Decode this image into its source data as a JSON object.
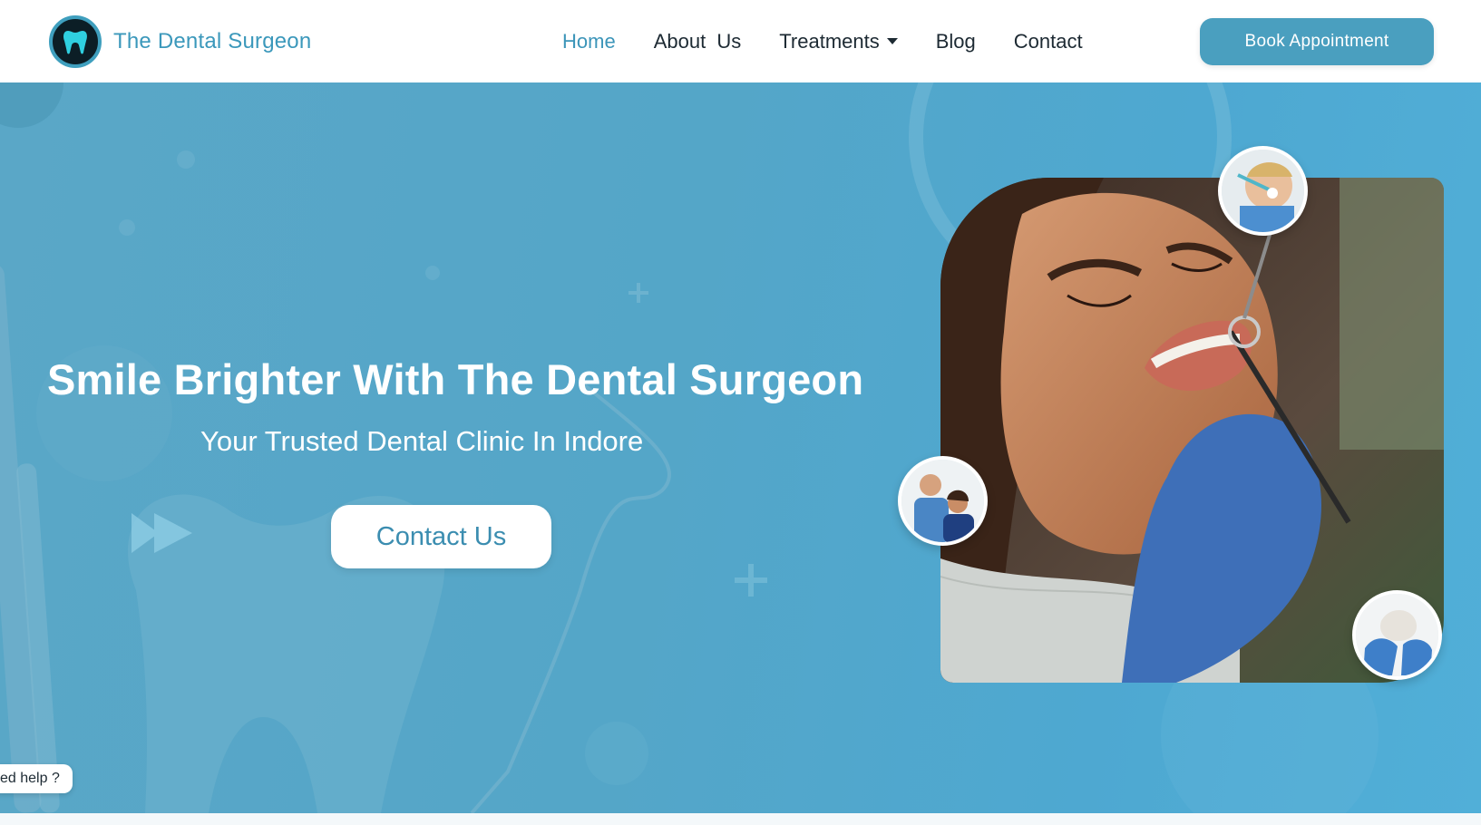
{
  "brand": {
    "name": "The Dental Surgeon",
    "logo_icon": "tooth-icon",
    "color_primary": "#3b98bb",
    "color_button": "#4a9fbf"
  },
  "nav": {
    "items": [
      {
        "label": "Home",
        "active": true
      },
      {
        "label": "About  Us",
        "active": false
      },
      {
        "label": "Treatments",
        "active": false,
        "icon": "caret-down-icon"
      },
      {
        "label": "Blog",
        "active": false
      },
      {
        "label": "Contact",
        "active": false
      }
    ],
    "cta_label": "Book Appointment"
  },
  "hero": {
    "title": "Smile Brighter With The Dental Surgeon",
    "subtitle": "Your Trusted Dental Clinic In Indore",
    "cta_label": "Contact Us",
    "background_color": "#54a6c8"
  },
  "help_chip": {
    "text": "ed help ?"
  }
}
